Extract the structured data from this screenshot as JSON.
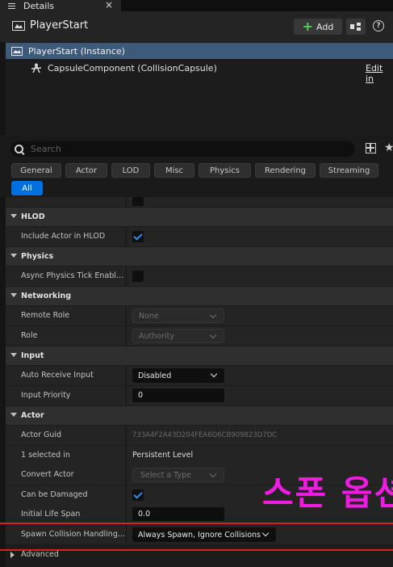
{
  "tab": {
    "title": "Details",
    "close": "×"
  },
  "header": {
    "title": "PlayerStart",
    "add_label": "Add",
    "help": "?"
  },
  "tree": {
    "items": [
      {
        "label": "PlayerStart (Instance)",
        "selected": true
      },
      {
        "label": "CapsuleComponent (CollisionCapsule)"
      }
    ],
    "edit_link": "Edit in"
  },
  "search": {
    "placeholder": "Search",
    "value": ""
  },
  "filters": [
    "General",
    "Actor",
    "LOD",
    "Misc",
    "Physics",
    "Rendering",
    "Streaming",
    "All"
  ],
  "sections": {
    "hlod": {
      "title": "HLOD",
      "include_label": "Include Actor in HLOD",
      "include_checked": true
    },
    "physics": {
      "title": "Physics",
      "async_label": "Async Physics Tick Enabl...",
      "async_checked": false
    },
    "networking": {
      "title": "Networking",
      "remote_role_label": "Remote Role",
      "remote_role_value": "None",
      "role_label": "Role",
      "role_value": "Authority"
    },
    "input": {
      "title": "Input",
      "auto_receive_label": "Auto Receive Input",
      "auto_receive_value": "Disabled",
      "priority_label": "Input Priority",
      "priority_value": "0"
    },
    "actor": {
      "title": "Actor",
      "guid_label": "Actor Guid",
      "guid_value": "733A4F2A43D204FEA6D6CB909823D7DC",
      "selected_in_label": "1 selected in",
      "selected_in_value": "Persistent Level",
      "convert_label": "Convert Actor",
      "convert_value": "Select a Type",
      "damaged_label": "Can be Damaged",
      "damaged_checked": true,
      "life_span_label": "Initial Life Span",
      "life_span_value": "0.0",
      "spawn_label": "Spawn Collision Handling...",
      "spawn_value": "Always Spawn, Ignore Collisions"
    }
  },
  "advanced_label": "Advanced",
  "annotation": "스폰 옵션",
  "colors": {
    "accent": "#0070e0",
    "selection": "#3e5a7a",
    "annotation": "#ee1ce0",
    "highlight": "#e01e1e"
  }
}
